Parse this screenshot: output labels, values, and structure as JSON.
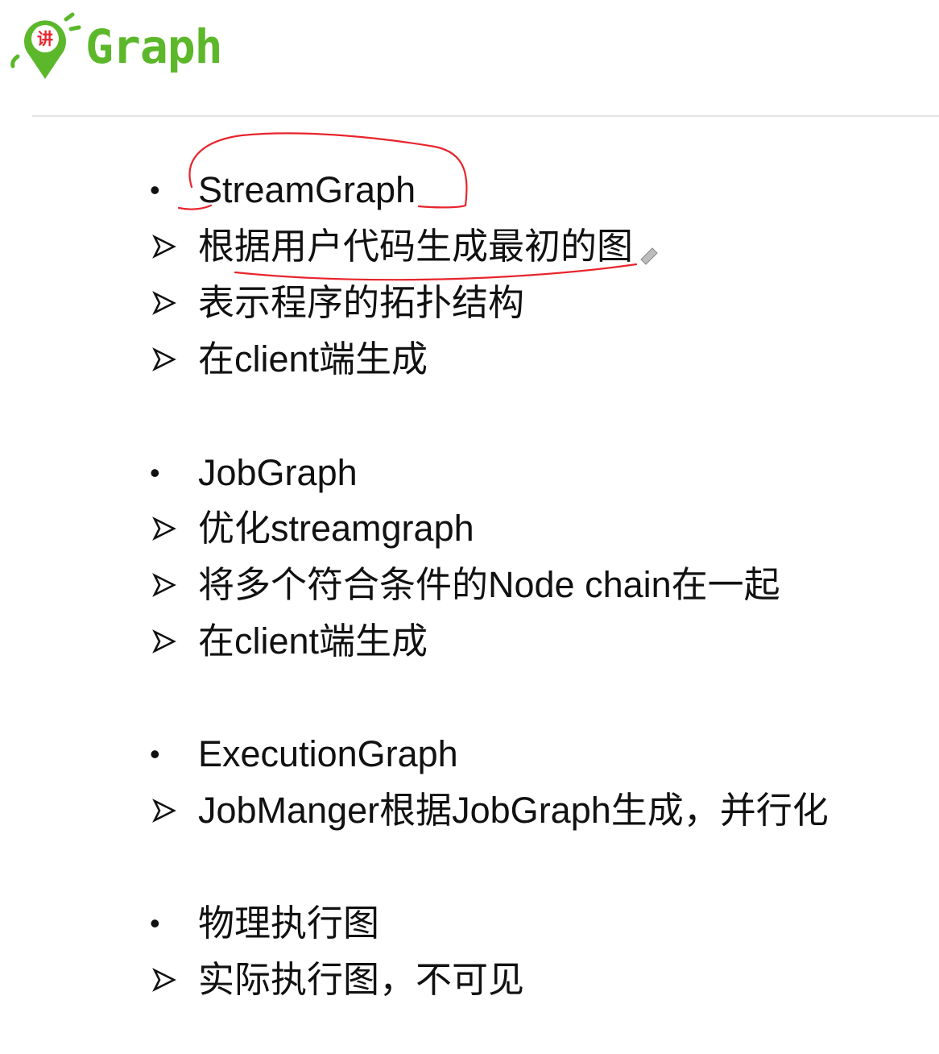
{
  "header": {
    "logo_char": "讲",
    "title": "Graph"
  },
  "sections": [
    {
      "heading": "StreamGraph",
      "items": [
        "根据用户代码生成最初的图",
        "表示程序的拓扑结构",
        "在client端生成"
      ]
    },
    {
      "heading": "JobGraph",
      "items": [
        "优化streamgraph",
        "将多个符合条件的Node chain在一起",
        "在client端生成"
      ]
    },
    {
      "heading": "ExecutionGraph",
      "items": [
        "JobManger根据JobGraph生成，并行化"
      ]
    },
    {
      "heading": "物理执行图",
      "items": [
        "实际执行图，不可见"
      ]
    }
  ],
  "colors": {
    "brand_green": "#5cb82a",
    "annotation_red": "#e8242c",
    "text": "#111111"
  }
}
